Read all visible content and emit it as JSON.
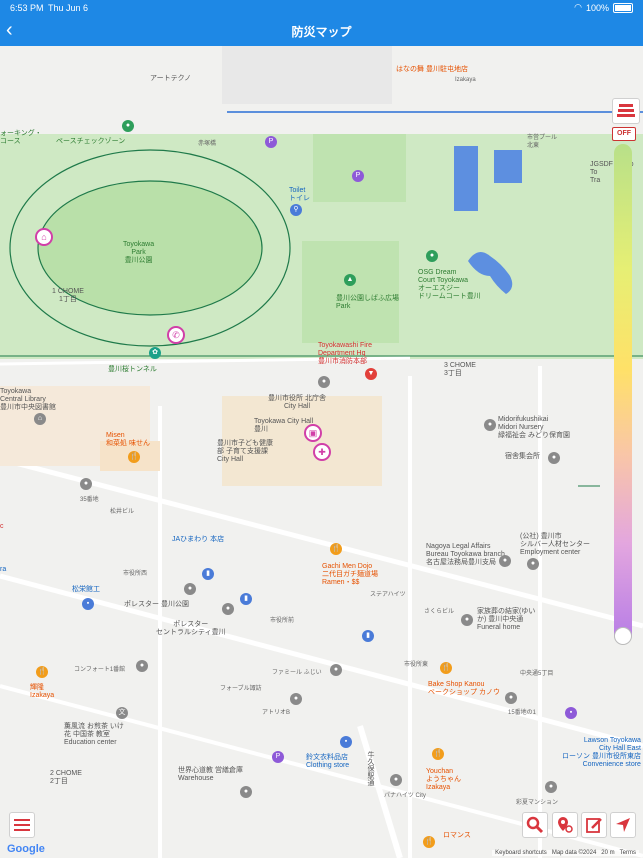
{
  "status_bar": {
    "time": "6:53 PM",
    "day": "Thu Jun 6",
    "battery": "100%"
  },
  "nav": {
    "back_icon": "chevron-left-icon",
    "title": "防災マップ"
  },
  "map_labels": {
    "art_techno": "アートテクノ",
    "hananomai": "はなの舞 豊川駐屯地店",
    "izakaya": "Izakaya",
    "walking_course": "ォーキング・\nコース",
    "pace_check": "ペースチェックゾーン",
    "akatsuka": "赤塚橋",
    "toilet": "Toilet\nトイレ",
    "shiei_pool": "市営プール\n北東",
    "jgsdf": "JGSDF Camp\nTo\nTra",
    "toyokawa_park": "Toyokawa\nPark\n豊川公園",
    "chome1": "1 CHOME\n1丁目",
    "osg": "OSG Dream\nCourt Toyokawa\nオーエスジー\nドリームコート豊川",
    "shibafu": "豊川公園しばふ広場\nPark",
    "tunnel": "豊川桜トンネル",
    "fire_dept": "Toyokawashi Fire\nDepartment Hq\n豊川市消防本部",
    "chome3": "3 CHOME\n3丁目",
    "central_library": "Toyokawa\nCentral Library\n豊川市中央図書館",
    "city_hall_north": "豊川市役所 北庁舎\nCity Hall",
    "midori": "Midorifukushikai\nMidori Nursery\n緑福祉会 みどり保育園",
    "city_hall": "Toyokawa City Hall\n豊川",
    "mizen": "Misen\n和菜処 味せん",
    "kodomo": "豊川市子ども健康\n部 子育て支援課\nCity Hall",
    "shukusha": "宿舎集会所",
    "banchi35": "35番地",
    "matsui": "松井ビル",
    "ja_himawari": "JAひまわり 本店",
    "gachi_men": "Gachi Men Dojo\n二代目ガチ麺道場\nRamen・$$",
    "nagoya_legal": "Nagoya Legal Affairs\nBureau Toyokawa branch\n名古屋法務局豊川支局",
    "silver": "(公社) 豊川市\nシルバー人材センター\nEmployment center",
    "ichiyaku_nishi": "市役所西",
    "ichiyaku_mae": "市役所前",
    "shogaku": "松栄館工",
    "polestar_park": "ポレスター 豊川公園",
    "polestar_central": "ポレスター\nセントラルシティ豊川",
    "stair": "ステアハイツ",
    "sakura_bld": "さくらビル",
    "kazokuso": "家族葬の結家(ゆい\nか) 豊川中央通\nFuneral home",
    "shiyakusho_higashi": "市役所東",
    "comfort": "コンフォート1番館",
    "familia": "ファミール ふじい",
    "forever": "フォーブル諏訪",
    "bake_shop": "Bake Shop Kanou\nベークショップ カノウ",
    "chuo5": "中央通5丁目",
    "nichiryu": "輝隆\nIzakaya",
    "iroha": "薫風流 お煎茶 いけ\n花 中国茶 教室\nEducation center",
    "atoria": "アトリオB",
    "ban15": "15番地の1",
    "lawson": "Lawson Toyokawa\nCity Hall East\nローソン 豊川市役所東店\nConvenience store",
    "suzubun": "鈴文衣料品店\nClothing store",
    "sekai": "世界心道教 営繕倉庫\nWarehouse",
    "chome2": "2 CHOME\n2丁目",
    "ushikubo": "牛久保駅通",
    "youchan": "Youchan\nようちゃん\nIzakaya",
    "sai_mansion": "彩夏マンション",
    "paper": "パナハイツ City",
    "romance": "ロマンス",
    "c_text": "c",
    "ra": "ra"
  },
  "controls": {
    "off_label": "OFF",
    "legend_icon": "hazard-legend-icon",
    "menu_icon": "hamburger-menu-icon",
    "search_icon": "search-icon",
    "pin_search_icon": "pin-search-icon",
    "edit_icon": "edit-icon",
    "location_icon": "location-arrow-icon"
  },
  "slider": {
    "value": 0.0
  },
  "footer": {
    "google": "Google",
    "keyboard_shortcuts": "Keyboard shortcuts",
    "map_data": "Map data ©2024",
    "scale": "20 m",
    "terms": "Terms"
  },
  "colors": {
    "header": "#1e88e5",
    "park": "#cfe9c4",
    "road": "#ffffff",
    "hazard": "#d13fa8",
    "tool_red": "#d9363e"
  }
}
